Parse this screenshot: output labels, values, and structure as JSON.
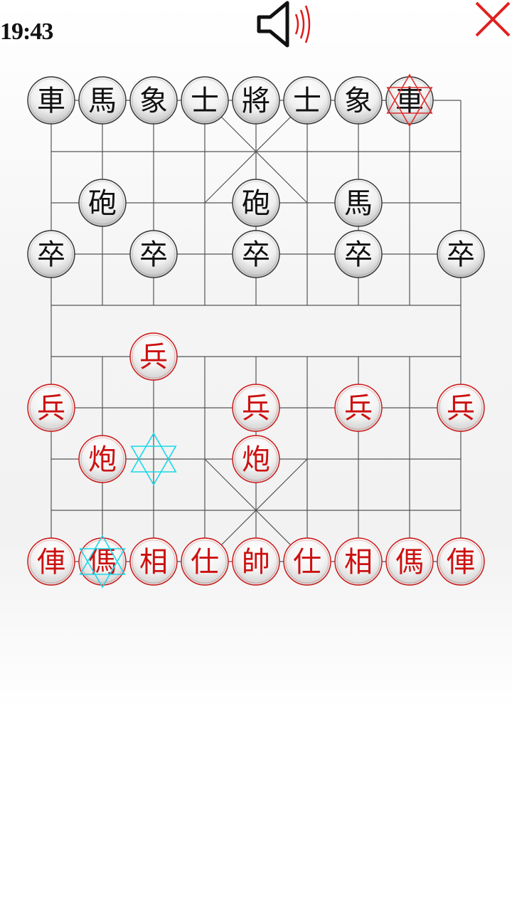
{
  "status": {
    "time": "19:43"
  },
  "icons": {
    "sound": "speaker-icon",
    "close": "close-icon"
  },
  "colors": {
    "red": "#cc1111",
    "black": "#111111",
    "highlight_cyan": "#19d9e8",
    "highlight_red": "#e03030",
    "line": "#555555"
  },
  "pieces": [
    {
      "col": 0,
      "row": 0,
      "label": "車",
      "side": "black"
    },
    {
      "col": 1,
      "row": 0,
      "label": "馬",
      "side": "black"
    },
    {
      "col": 2,
      "row": 0,
      "label": "象",
      "side": "black"
    },
    {
      "col": 3,
      "row": 0,
      "label": "士",
      "side": "black"
    },
    {
      "col": 4,
      "row": 0,
      "label": "將",
      "side": "black"
    },
    {
      "col": 5,
      "row": 0,
      "label": "士",
      "side": "black"
    },
    {
      "col": 6,
      "row": 0,
      "label": "象",
      "side": "black"
    },
    {
      "col": 7,
      "row": 0,
      "label": "車",
      "side": "black"
    },
    {
      "col": 1,
      "row": 2,
      "label": "砲",
      "side": "black"
    },
    {
      "col": 4,
      "row": 2,
      "label": "砲",
      "side": "black"
    },
    {
      "col": 6,
      "row": 2,
      "label": "馬",
      "side": "black"
    },
    {
      "col": 0,
      "row": 3,
      "label": "卒",
      "side": "black"
    },
    {
      "col": 2,
      "row": 3,
      "label": "卒",
      "side": "black"
    },
    {
      "col": 4,
      "row": 3,
      "label": "卒",
      "side": "black"
    },
    {
      "col": 6,
      "row": 3,
      "label": "卒",
      "side": "black"
    },
    {
      "col": 8,
      "row": 3,
      "label": "卒",
      "side": "black"
    },
    {
      "col": 2,
      "row": 5,
      "label": "兵",
      "side": "red"
    },
    {
      "col": 0,
      "row": 6,
      "label": "兵",
      "side": "red"
    },
    {
      "col": 4,
      "row": 6,
      "label": "兵",
      "side": "red"
    },
    {
      "col": 6,
      "row": 6,
      "label": "兵",
      "side": "red"
    },
    {
      "col": 8,
      "row": 6,
      "label": "兵",
      "side": "red"
    },
    {
      "col": 1,
      "row": 7,
      "label": "炮",
      "side": "red"
    },
    {
      "col": 4,
      "row": 7,
      "label": "炮",
      "side": "red"
    },
    {
      "col": 0,
      "row": 9,
      "label": "俥",
      "side": "red"
    },
    {
      "col": 1,
      "row": 9,
      "label": "傌",
      "side": "red"
    },
    {
      "col": 2,
      "row": 9,
      "label": "相",
      "side": "red"
    },
    {
      "col": 3,
      "row": 9,
      "label": "仕",
      "side": "red"
    },
    {
      "col": 4,
      "row": 9,
      "label": "帥",
      "side": "red"
    },
    {
      "col": 5,
      "row": 9,
      "label": "仕",
      "side": "red"
    },
    {
      "col": 6,
      "row": 9,
      "label": "相",
      "side": "red"
    },
    {
      "col": 7,
      "row": 9,
      "label": "傌",
      "side": "red"
    },
    {
      "col": 8,
      "row": 9,
      "label": "俥",
      "side": "red"
    }
  ],
  "highlights": [
    {
      "col": 7,
      "row": 0,
      "color": "#e03030",
      "name": "last-move-marker"
    },
    {
      "col": 2,
      "row": 7,
      "color": "#19d9e8",
      "name": "move-target-marker"
    },
    {
      "col": 1,
      "row": 9,
      "color": "#19d9e8",
      "name": "selected-piece-marker"
    }
  ]
}
